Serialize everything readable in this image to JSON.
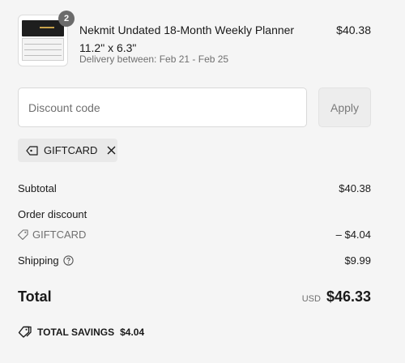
{
  "item": {
    "quantity": "2",
    "title": "Nekmit Undated 18-Month Weekly Planner 11.2\" x 6.3\"",
    "delivery": "Delivery between: Feb 21 - Feb 25",
    "price": "$40.38"
  },
  "discount": {
    "placeholder": "Discount code",
    "apply_label": "Apply",
    "applied_code": "GIFTCARD"
  },
  "summary": {
    "subtotal_label": "Subtotal",
    "subtotal_value": "$40.38",
    "order_discount_label": "Order discount",
    "discount_code": "GIFTCARD",
    "discount_value": "– $4.04",
    "shipping_label": "Shipping",
    "shipping_value": "$9.99",
    "total_label": "Total",
    "currency": "USD",
    "total_value": "$46.33",
    "savings_label": "TOTAL SAVINGS",
    "savings_value": "$4.04"
  },
  "icons": {
    "tag": "tag-icon",
    "close": "close-icon",
    "help": "question-circle-icon",
    "savings": "savings-tag-icon"
  }
}
